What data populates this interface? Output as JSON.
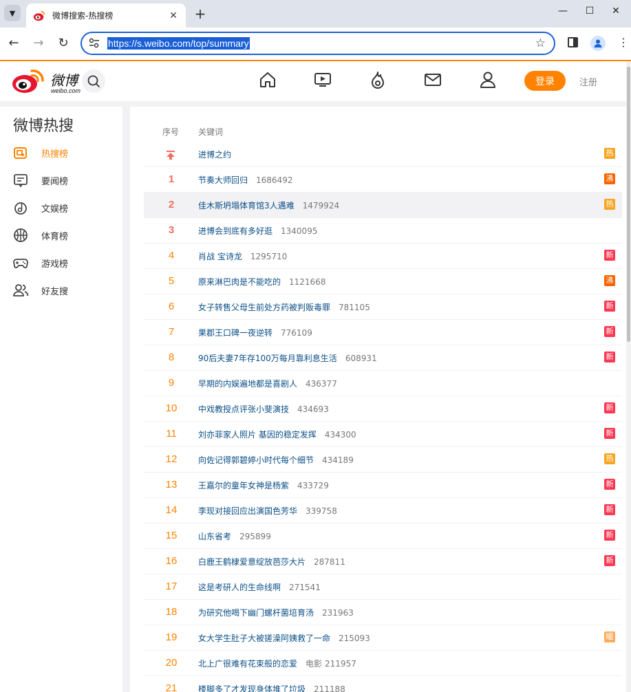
{
  "browser": {
    "tab_title": "微博搜索-热搜榜",
    "tab_close": "✕",
    "new_tab": "+",
    "url": "https://s.weibo.com/top/summary"
  },
  "header": {
    "logo_text": "微博",
    "logo_sub": "weibo.com",
    "login": "登录",
    "register": "注册"
  },
  "sidebar": {
    "title": "微博热搜",
    "items": [
      {
        "label": "热搜榜",
        "icon": "hot-search-icon"
      },
      {
        "label": "要闻榜",
        "icon": "news-icon"
      },
      {
        "label": "文娱榜",
        "icon": "music-disc-icon"
      },
      {
        "label": "体育榜",
        "icon": "basketball-icon"
      },
      {
        "label": "游戏榜",
        "icon": "gamepad-icon"
      },
      {
        "label": "好友搜",
        "icon": "friends-icon"
      }
    ]
  },
  "table": {
    "col_rank": "序号",
    "col_keyword": "关键词",
    "colors": {
      "hot": "#f7a521",
      "boil": "#f86400",
      "new": "#ff3852",
      "warm": "#ffab5a"
    },
    "rows": [
      {
        "rank": "",
        "pinned": true,
        "keyword": "进博之约",
        "count": "",
        "category": "",
        "badge": "热",
        "badge_type": "hot"
      },
      {
        "rank": "1",
        "keyword": "节奏大师回归",
        "count": "1686492",
        "category": "",
        "badge": "沸",
        "badge_type": "boil"
      },
      {
        "rank": "2",
        "keyword": "佳木斯坍塌体育馆3人遇难",
        "count": "1479924",
        "category": "",
        "badge": "热",
        "badge_type": "hot"
      },
      {
        "rank": "3",
        "keyword": "进博会到底有多好逛",
        "count": "1340095",
        "category": "",
        "badge": "",
        "badge_type": ""
      },
      {
        "rank": "4",
        "keyword": "肖战 宝诗龙",
        "count": "1295710",
        "category": "",
        "badge": "新",
        "badge_type": "new"
      },
      {
        "rank": "5",
        "keyword": "原来淋巴肉是不能吃的",
        "count": "1121668",
        "category": "",
        "badge": "沸",
        "badge_type": "boil"
      },
      {
        "rank": "6",
        "keyword": "女子转售父母生前处方药被判贩毒罪",
        "count": "781105",
        "category": "",
        "badge": "新",
        "badge_type": "new"
      },
      {
        "rank": "7",
        "keyword": "果郡王口碑一夜逆转",
        "count": "776109",
        "category": "",
        "badge": "新",
        "badge_type": "new"
      },
      {
        "rank": "8",
        "keyword": "90后夫妻7年存100万每月靠利息生活",
        "count": "608931",
        "category": "",
        "badge": "新",
        "badge_type": "new"
      },
      {
        "rank": "9",
        "keyword": "早期的内娱遍地都是喜剧人",
        "count": "436377",
        "category": "",
        "badge": "",
        "badge_type": ""
      },
      {
        "rank": "10",
        "keyword": "中戏教授点评张小斐演技",
        "count": "434693",
        "category": "",
        "badge": "新",
        "badge_type": "new"
      },
      {
        "rank": "11",
        "keyword": "刘亦菲家人照片 基因的稳定发挥",
        "count": "434300",
        "category": "",
        "badge": "新",
        "badge_type": "new"
      },
      {
        "rank": "12",
        "keyword": "向佐记得郭碧婷小时代每个细节",
        "count": "434189",
        "category": "",
        "badge": "热",
        "badge_type": "hot"
      },
      {
        "rank": "13",
        "keyword": "王嘉尔的童年女神是杨紫",
        "count": "433729",
        "category": "",
        "badge": "新",
        "badge_type": "new"
      },
      {
        "rank": "14",
        "keyword": "李现对接回应出演国色芳华",
        "count": "339758",
        "category": "",
        "badge": "新",
        "badge_type": "new"
      },
      {
        "rank": "15",
        "keyword": "山东省考",
        "count": "295899",
        "category": "",
        "badge": "新",
        "badge_type": "new"
      },
      {
        "rank": "16",
        "keyword": "白鹿王鹤棣爱意绽放芭莎大片",
        "count": "287811",
        "category": "",
        "badge": "新",
        "badge_type": "new"
      },
      {
        "rank": "17",
        "keyword": "这是考研人的生命线啊",
        "count": "271541",
        "category": "",
        "badge": "",
        "badge_type": ""
      },
      {
        "rank": "18",
        "keyword": "为研究他喝下幽门螺杆菌培育汤",
        "count": "231963",
        "category": "",
        "badge": "",
        "badge_type": ""
      },
      {
        "rank": "19",
        "keyword": "女大学生肚子大被搓澡阿姨救了一命",
        "count": "215093",
        "category": "",
        "badge": "暖",
        "badge_type": "warm"
      },
      {
        "rank": "20",
        "keyword": "北上广很难有花束般的恋爱",
        "count": "211957",
        "category": "电影",
        "badge": "",
        "badge_type": ""
      },
      {
        "rank": "21",
        "keyword": "楼脚多了才发现身体堆了垃圾",
        "count": "211188",
        "category": "",
        "badge": "",
        "badge_type": ""
      }
    ]
  }
}
